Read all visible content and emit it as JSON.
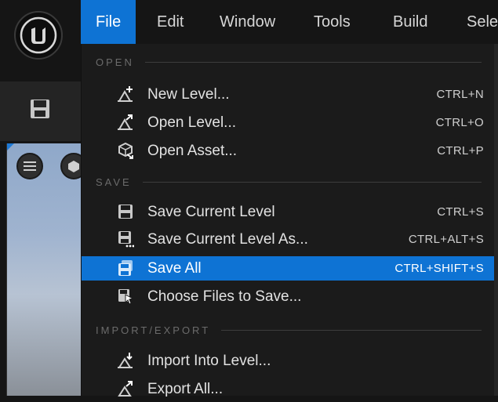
{
  "menubar": {
    "items": [
      {
        "label": "File",
        "active": true
      },
      {
        "label": "Edit",
        "active": false
      },
      {
        "label": "Window",
        "active": false
      },
      {
        "label": "Tools",
        "active": false
      },
      {
        "label": "Build",
        "active": false
      },
      {
        "label": "Sele",
        "active": false
      }
    ]
  },
  "colors": {
    "accent": "#0e73d4",
    "menu_bg": "#1b1b1b",
    "text": "#e2e2e2",
    "section": "#6b6b6b"
  },
  "file_menu": {
    "sections": [
      {
        "label": "OPEN",
        "items": [
          {
            "label": "New Level...",
            "shortcut": "CTRL+N",
            "icon": "new-level-icon"
          },
          {
            "label": "Open Level...",
            "shortcut": "CTRL+O",
            "icon": "open-level-icon"
          },
          {
            "label": "Open Asset...",
            "shortcut": "CTRL+P",
            "icon": "open-asset-icon"
          }
        ]
      },
      {
        "label": "SAVE",
        "items": [
          {
            "label": "Save Current Level",
            "shortcut": "CTRL+S",
            "icon": "save-icon"
          },
          {
            "label": "Save Current Level As...",
            "shortcut": "CTRL+ALT+S",
            "icon": "save-as-icon"
          },
          {
            "label": "Save All",
            "shortcut": "CTRL+SHIFT+S",
            "icon": "save-all-icon",
            "highlighted": true
          },
          {
            "label": "Choose Files to Save...",
            "shortcut": "",
            "icon": "choose-files-icon"
          }
        ]
      },
      {
        "label": "IMPORT/EXPORT",
        "items": [
          {
            "label": "Import Into Level...",
            "shortcut": "",
            "icon": "import-icon"
          },
          {
            "label": "Export All...",
            "shortcut": "",
            "icon": "export-icon"
          }
        ]
      }
    ]
  }
}
